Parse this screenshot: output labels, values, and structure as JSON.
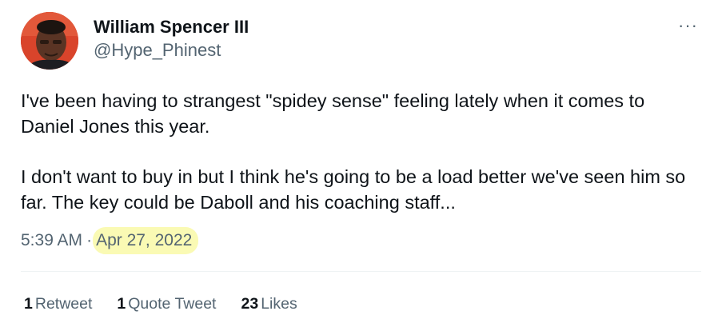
{
  "author": {
    "display_name": "William Spencer III",
    "handle": "@Hype_Phinest"
  },
  "menu": {
    "more_label": "···"
  },
  "tweet": {
    "paragraphs": [
      "I've been having to strangest \"spidey sense\" feeling lately when it comes to Daniel Jones this year.",
      "I don't want to buy in but I think he's going to be a load better we've seen him so far. The key could be Daboll and his coaching staff..."
    ]
  },
  "meta": {
    "time": "5:39 AM",
    "separator": "·",
    "date": "Apr 27, 2022"
  },
  "stats": {
    "retweets": {
      "count": "1",
      "label": "Retweet"
    },
    "quotes": {
      "count": "1",
      "label": "Quote Tweet"
    },
    "likes": {
      "count": "23",
      "label": "Likes"
    }
  },
  "colors": {
    "text": "#0f1419",
    "secondary": "#536471",
    "date_highlight": "#fafab4",
    "avatar_background": "#d9442b"
  }
}
